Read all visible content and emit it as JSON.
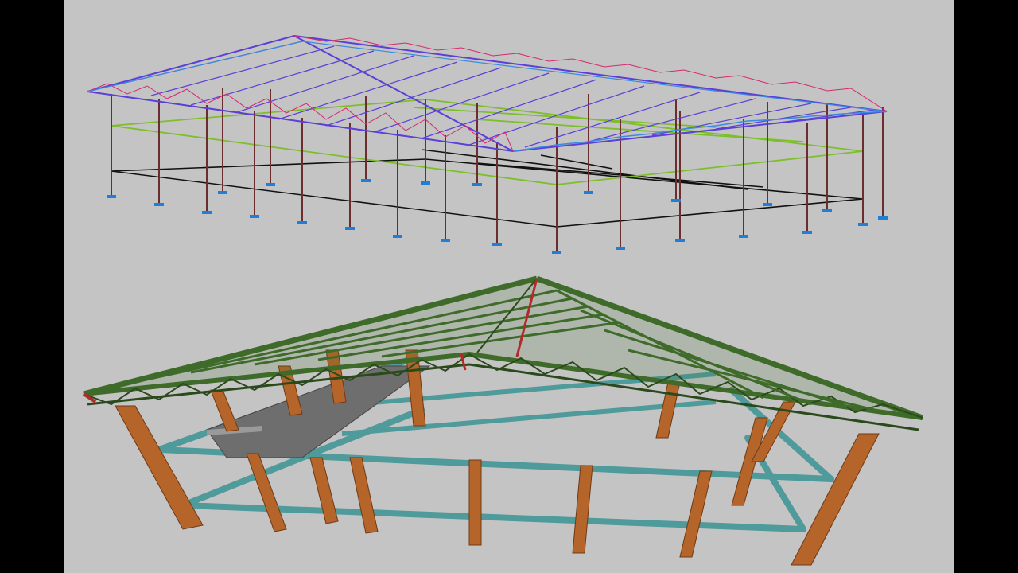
{
  "window": {
    "title": ""
  },
  "views": [
    {
      "id": "wireframe-analytical-model",
      "style": "wireframe"
    },
    {
      "id": "rendered-3d-model",
      "style": "shaded"
    }
  ],
  "colors": {
    "background": "#c4c4c4",
    "letterbox": "#000000",
    "roof_truss_wire": "#5b3fd6",
    "truss_diagonals_wire": "#d6286e",
    "purlin_wire": "#3a8be0",
    "tie_beam_wire": "#7dbf2a",
    "column_wire": "#6b2d2d",
    "ground_beam_wire": "#111111",
    "support_symbol": "#1e7fd8",
    "truss_render": "#3f6b2a",
    "truss_web_render": "#2a4a1c",
    "column_render": "#b5642a",
    "beam_render": "#4f9a9a",
    "slab_render": "#6e6e6e"
  }
}
